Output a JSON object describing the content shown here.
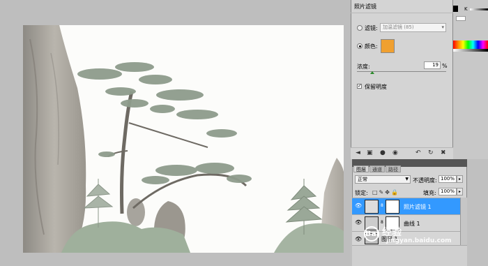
{
  "photo_filter": {
    "panel_title": "照片滤镜",
    "filter_label": "滤镜:",
    "filter_value": "加温滤镜 (85)",
    "color_label": "颜色:",
    "color_value": "#f0a030",
    "density_label": "浓度:",
    "density_value": "19",
    "density_unit": "%",
    "density_level": 0.19,
    "preserve_label": "保留明度",
    "preserve_checked": true,
    "selected_option": "color"
  },
  "color_panel": {
    "channel_label": "K"
  },
  "layers_panel": {
    "tabs": [
      "图层",
      "通道",
      "路径"
    ],
    "active_tab": "图层",
    "blend_mode": "正常",
    "opacity_label": "不透明度:",
    "opacity_value": "100%",
    "lock_label": "锁定:",
    "fill_label": "填充:",
    "fill_value": "100%",
    "layers": [
      {
        "name": "照片滤镜 1",
        "selected": true,
        "visible": true
      },
      {
        "name": "曲线 1",
        "selected": false,
        "visible": true
      },
      {
        "name": "图层 1",
        "selected": false,
        "visible": true
      }
    ]
  },
  "watermark": {
    "brand": "经验",
    "badge": "Bai",
    "sub": "jingyan.baidu.com"
  },
  "icons": [
    "radio-icon",
    "eye-icon",
    "link-icon",
    "lock-icon",
    "brush-icon",
    "move-icon",
    "delete-icon"
  ],
  "colors": {
    "selection": "#3399ff",
    "panel_bg": "#d4d4d4",
    "workspace": "#bebebe"
  }
}
